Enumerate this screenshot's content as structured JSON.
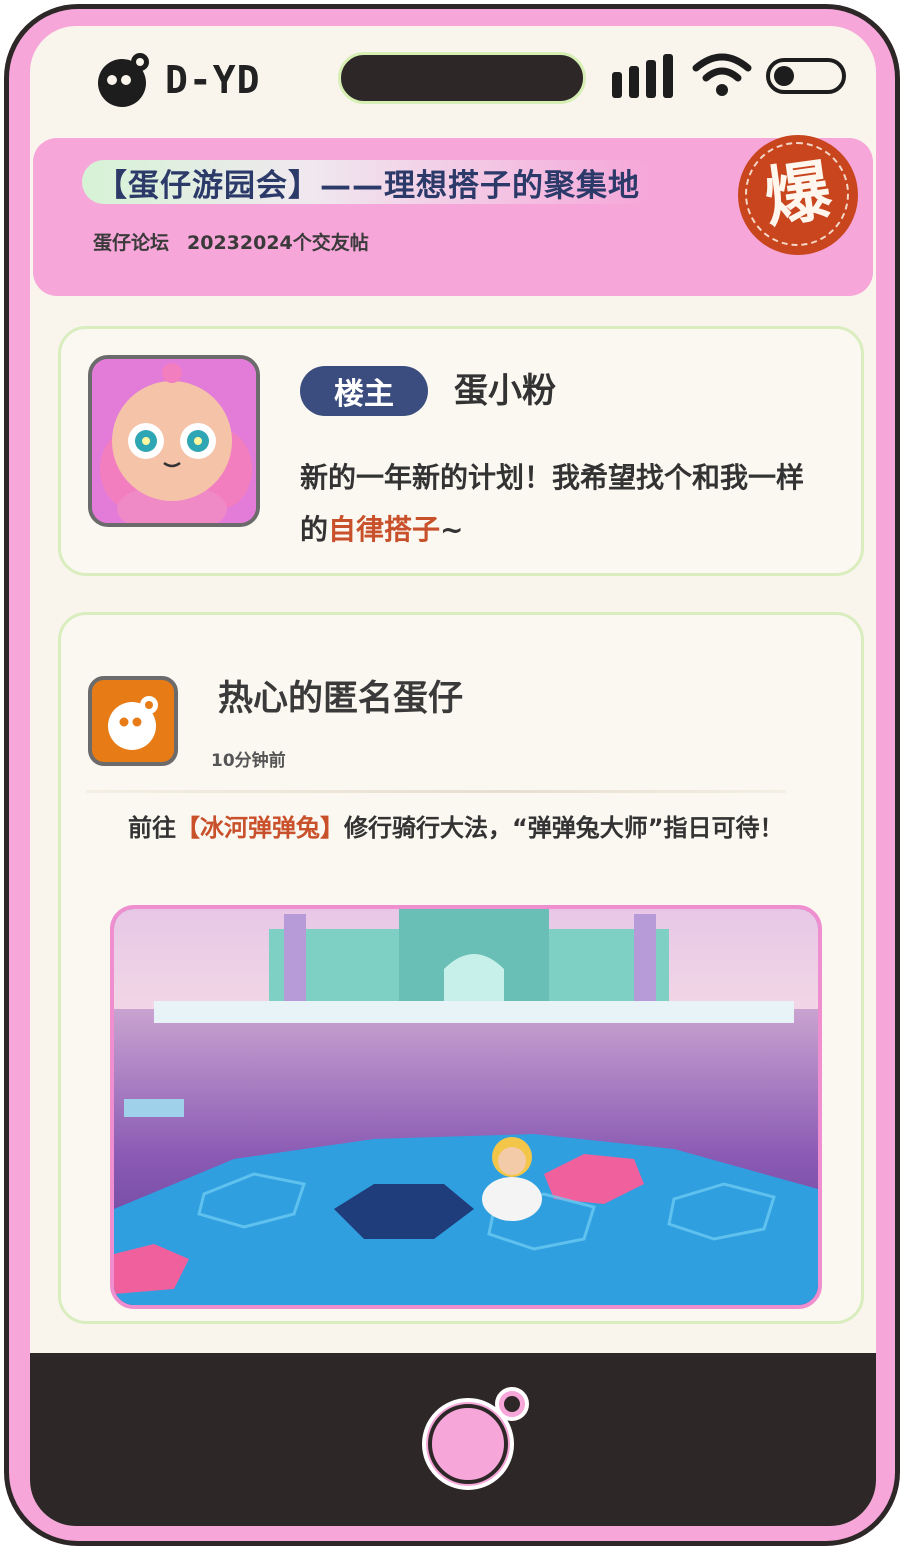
{
  "status_bar": {
    "brand": "D-YD",
    "icons": [
      "logo-egg-icon",
      "signal-bars-icon",
      "wifi-icon",
      "battery-icon"
    ]
  },
  "banner": {
    "title": "【蛋仔游园会】——理想搭子的聚集地",
    "sub_source": "蛋仔论坛",
    "sub_topic": "20232024个交友帖",
    "hot_badge": "爆"
  },
  "op_post": {
    "role": "楼主",
    "name": "蛋小粉",
    "text_before": "新的一年新的计划！我希望找个和我一样的",
    "text_highlight": "自律搭子",
    "text_after": "~"
  },
  "reply": {
    "name": "热心的匿名蛋仔",
    "time": "10分钟前",
    "text_before": "前往",
    "text_highlight": "【冰河弹弹兔】",
    "text_after": "修行骑行大法，“弹弹兔大师”指日可待！"
  },
  "colors": {
    "frame": "#f6a6d9",
    "dark": "#2e2727",
    "accent_red": "#c8512b",
    "navy": "#3b4d7e",
    "card_border": "#d9edbf"
  }
}
